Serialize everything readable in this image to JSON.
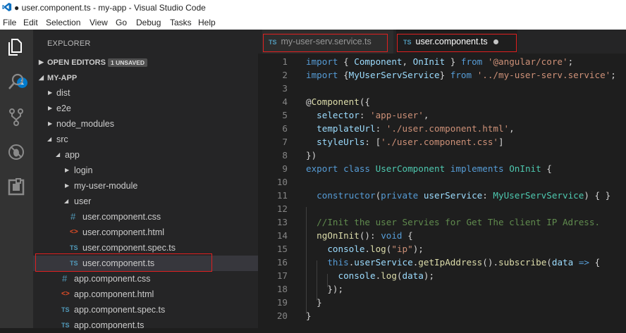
{
  "window": {
    "title": "● user.component.ts - my-app - Visual Studio Code"
  },
  "menu": [
    "File",
    "Edit",
    "Selection",
    "View",
    "Go",
    "Debug",
    "Tasks",
    "Help"
  ],
  "activity": {
    "badge": "1"
  },
  "explorer": {
    "title": "EXPLORER",
    "open_editors": {
      "label": "OPEN EDITORS",
      "chip": "1 UNSAVED"
    },
    "project": "MY-APP",
    "items": [
      {
        "label": "dist"
      },
      {
        "label": "e2e"
      },
      {
        "label": "node_modules"
      },
      {
        "label": "src"
      },
      {
        "label": "app"
      },
      {
        "label": "login"
      },
      {
        "label": "my-user-module"
      },
      {
        "label": "user"
      },
      {
        "label": "user.component.css",
        "icon": "#"
      },
      {
        "label": "user.component.html",
        "icon": "<>"
      },
      {
        "label": "user.component.spec.ts",
        "icon": "TS"
      },
      {
        "label": "user.component.ts",
        "icon": "TS"
      },
      {
        "label": "app.component.css",
        "icon": "#"
      },
      {
        "label": "app.component.html",
        "icon": "<>"
      },
      {
        "label": "app.component.spec.ts",
        "icon": "TS"
      },
      {
        "label": "app.component.ts",
        "icon": "TS"
      }
    ]
  },
  "tabs": [
    {
      "icon": "TS",
      "label": "my-user-serv.service.ts"
    },
    {
      "icon": "TS",
      "label": "user.component.ts"
    }
  ],
  "editor": {
    "line_numbers": [
      "1",
      "2",
      "3",
      "4",
      "5",
      "6",
      "7",
      "8",
      "9",
      "10",
      "11",
      "12",
      "13",
      "14",
      "15",
      "16",
      "17",
      "18",
      "19",
      "20"
    ],
    "lines": [
      [
        [
          "k",
          "import"
        ],
        [
          "d",
          " { "
        ],
        [
          "v",
          "Component"
        ],
        [
          "d",
          ", "
        ],
        [
          "v",
          "OnInit"
        ],
        [
          "d",
          " } "
        ],
        [
          "k",
          "from"
        ],
        [
          "d",
          " "
        ],
        [
          "s",
          "'@angular/core'"
        ],
        [
          "d",
          ";"
        ]
      ],
      [
        [
          "k",
          "import"
        ],
        [
          "d",
          " {"
        ],
        [
          "v",
          "MyUserServService"
        ],
        [
          "d",
          "} "
        ],
        [
          "k",
          "from"
        ],
        [
          "d",
          " "
        ],
        [
          "s",
          "'../my-user-serv.service'"
        ],
        [
          "d",
          ";"
        ]
      ],
      [],
      [
        [
          "d",
          "@"
        ],
        [
          "f",
          "Component"
        ],
        [
          "d",
          "({"
        ]
      ],
      [
        [
          "d",
          "  "
        ],
        [
          "v",
          "selector"
        ],
        [
          "d",
          ": "
        ],
        [
          "s",
          "'app-user'"
        ],
        [
          "d",
          ","
        ]
      ],
      [
        [
          "d",
          "  "
        ],
        [
          "v",
          "templateUrl"
        ],
        [
          "d",
          ": "
        ],
        [
          "s",
          "'./user.component.html'"
        ],
        [
          "d",
          ","
        ]
      ],
      [
        [
          "d",
          "  "
        ],
        [
          "v",
          "styleUrls"
        ],
        [
          "d",
          ": ["
        ],
        [
          "s",
          "'./user.component.css'"
        ],
        [
          "d",
          "]"
        ]
      ],
      [
        [
          "d",
          "})"
        ]
      ],
      [
        [
          "k",
          "export"
        ],
        [
          "d",
          " "
        ],
        [
          "k",
          "class"
        ],
        [
          "d",
          " "
        ],
        [
          "t",
          "UserComponent"
        ],
        [
          "d",
          " "
        ],
        [
          "k",
          "implements"
        ],
        [
          "d",
          " "
        ],
        [
          "t",
          "OnInit"
        ],
        [
          "d",
          " {"
        ]
      ],
      [],
      [
        [
          "d",
          "  "
        ],
        [
          "k",
          "constructor"
        ],
        [
          "d",
          "("
        ],
        [
          "k",
          "private"
        ],
        [
          "d",
          " "
        ],
        [
          "v",
          "userService"
        ],
        [
          "d",
          ": "
        ],
        [
          "t",
          "MyUserServService"
        ],
        [
          "d",
          ") { }"
        ]
      ],
      [],
      [
        [
          "d",
          "  "
        ],
        [
          "c",
          "//Init the user Servies for Get The client IP Adress."
        ]
      ],
      [
        [
          "d",
          "  "
        ],
        [
          "f",
          "ngOnInit"
        ],
        [
          "d",
          "(): "
        ],
        [
          "k",
          "void"
        ],
        [
          "d",
          " {"
        ]
      ],
      [
        [
          "d",
          "    "
        ],
        [
          "v",
          "console"
        ],
        [
          "d",
          "."
        ],
        [
          "f",
          "log"
        ],
        [
          "d",
          "("
        ],
        [
          "s",
          "\"ip\""
        ],
        [
          "d",
          ");"
        ]
      ],
      [
        [
          "d",
          "    "
        ],
        [
          "k",
          "this"
        ],
        [
          "d",
          "."
        ],
        [
          "v",
          "userService"
        ],
        [
          "d",
          "."
        ],
        [
          "f",
          "getIpAddress"
        ],
        [
          "d",
          "()."
        ],
        [
          "f",
          "subscribe"
        ],
        [
          "d",
          "("
        ],
        [
          "v",
          "data"
        ],
        [
          "d",
          " "
        ],
        [
          "k",
          "=>"
        ],
        [
          "d",
          " {"
        ]
      ],
      [
        [
          "d",
          "      "
        ],
        [
          "v",
          "console"
        ],
        [
          "d",
          "."
        ],
        [
          "f",
          "log"
        ],
        [
          "d",
          "("
        ],
        [
          "v",
          "data"
        ],
        [
          "d",
          ");"
        ]
      ],
      [
        [
          "d",
          "    });"
        ]
      ],
      [
        [
          "d",
          "  }"
        ]
      ],
      [
        [
          "d",
          "}"
        ]
      ]
    ]
  }
}
